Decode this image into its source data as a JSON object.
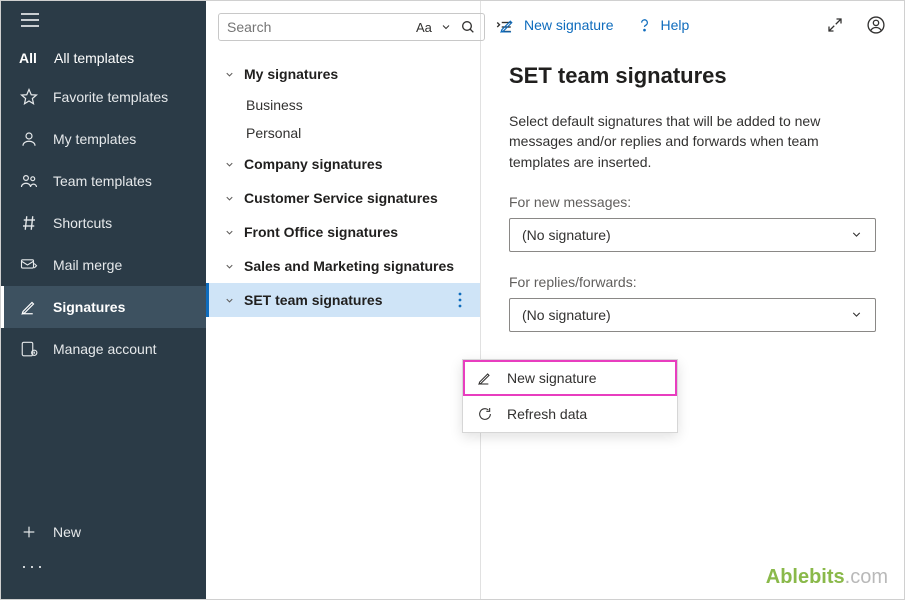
{
  "sidebar": {
    "tab_all": "All",
    "tab_all_label": "All templates",
    "items": [
      {
        "label": "Favorite templates"
      },
      {
        "label": "My templates"
      },
      {
        "label": "Team templates"
      },
      {
        "label": "Shortcuts"
      },
      {
        "label": "Mail merge"
      },
      {
        "label": "Signatures"
      },
      {
        "label": "Manage account"
      }
    ],
    "new_label": "New"
  },
  "search": {
    "placeholder": "Search",
    "aa": "Aa"
  },
  "tree": {
    "groups": [
      {
        "label": "My signatures",
        "leaves": [
          "Business",
          "Personal"
        ]
      },
      {
        "label": "Company signatures"
      },
      {
        "label": "Customer Service signatures"
      },
      {
        "label": "Front Office signatures"
      },
      {
        "label": "Sales and Marketing signatures"
      },
      {
        "label": "SET team  signatures",
        "selected": true
      }
    ]
  },
  "context_menu": {
    "items": [
      {
        "label": "New signature"
      },
      {
        "label": "Refresh data"
      }
    ]
  },
  "topbar": {
    "new_signature": "New signature",
    "help": "Help"
  },
  "detail": {
    "title": "SET team  signatures",
    "description": "Select default signatures that will be added to new messages and/or replies and forwards when team templates are inserted.",
    "for_new_label": "For new messages:",
    "for_new_value": "(No signature)",
    "for_replies_label": "For replies/forwards:",
    "for_replies_value": "(No signature)"
  },
  "brand": {
    "name": "Ablebits",
    "suffix": ".com"
  }
}
